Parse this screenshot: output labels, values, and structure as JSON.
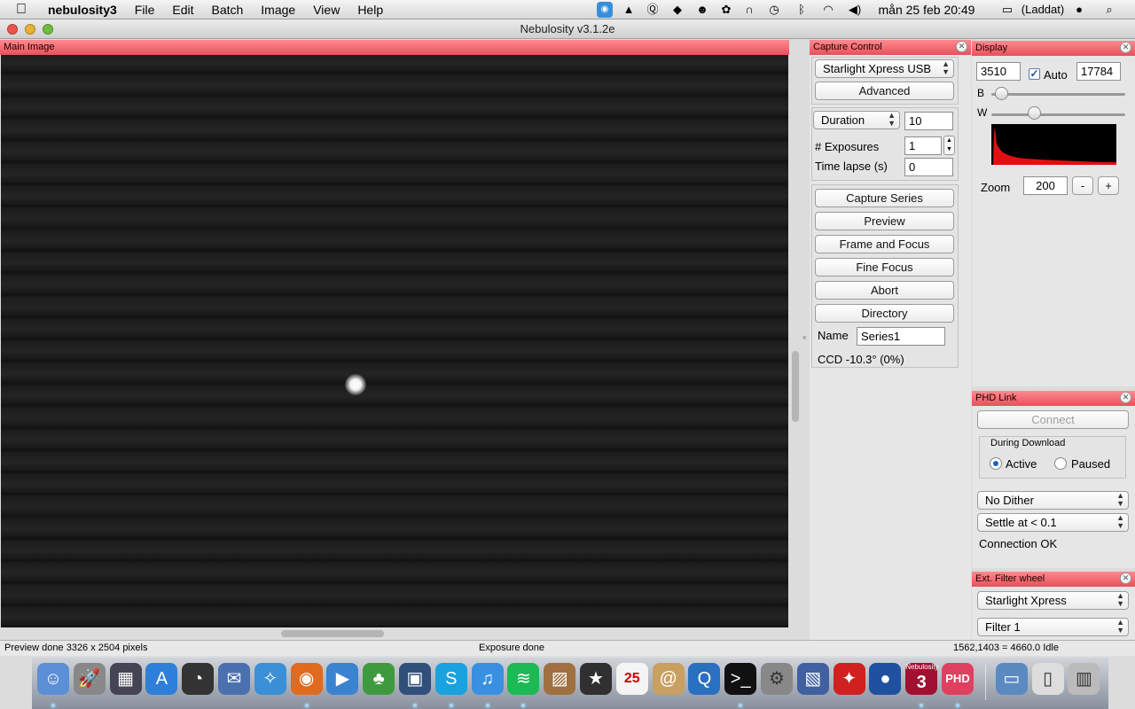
{
  "menubar": {
    "apple": "",
    "app_name": "nebulosity3",
    "items": [
      "File",
      "Edit",
      "Batch",
      "Image",
      "View",
      "Help"
    ],
    "clock": "mån 25 feb  20:49",
    "battery": "(Laddat)"
  },
  "window": {
    "title": "Nebulosity v3.1.2e"
  },
  "main_image": {
    "title": "Main Image"
  },
  "capture": {
    "title": "Capture Control",
    "camera": "Starlight Xpress USB",
    "advanced": "Advanced",
    "duration_label": "Duration",
    "duration_value": "10",
    "exposures_label": "# Exposures",
    "exposures_value": "1",
    "timelapse_label": "Time lapse (s)",
    "timelapse_value": "0",
    "buttons": {
      "capture_series": "Capture Series",
      "preview": "Preview",
      "frame_focus": "Frame and Focus",
      "fine_focus": "Fine Focus",
      "abort": "Abort",
      "directory": "Directory"
    },
    "name_label": "Name",
    "name_value": "Series1",
    "ccd_status": "CCD -10.3° (0%)"
  },
  "display": {
    "title": "Display",
    "black_value": "3510",
    "auto_label": "Auto",
    "auto_checked": true,
    "white_value": "17784",
    "b_label": "B",
    "w_label": "W",
    "b_level": 0.03,
    "w_level": 0.3,
    "zoom_label": "Zoom",
    "zoom_value": "200",
    "zoom_minus": "-",
    "zoom_plus": "+",
    "histogram_color": "#e01010"
  },
  "phd": {
    "title": "PHD Link",
    "connect": "Connect",
    "during_download": "During Download",
    "active": "Active",
    "paused": "Paused",
    "selected": "Active",
    "dither": "No Dither",
    "settle": "Settle at < 0.1",
    "status": "Connection OK"
  },
  "filter": {
    "title": "Ext. Filter wheel",
    "wheel": "Starlight Xpress",
    "filter": "Filter 1"
  },
  "status": {
    "left": "Preview done 3326 x 2504 pixels",
    "center": "Exposure done",
    "right": "1562,1403 = 4660.0  Idle"
  },
  "colors": {
    "panel_title": "#e8505a",
    "accent": "#1c5fc9"
  },
  "dock": {
    "icons": [
      "finder-icon",
      "launchpad-icon",
      "photo-booth-icon",
      "app-store-icon",
      "dashboard-icon",
      "mail-icon",
      "safari-icon",
      "firefox-icon",
      "facetime-icon",
      "evernote-icon",
      "quicktime-icon",
      "skype-icon",
      "itunes-icon",
      "spotify-icon",
      "iphoto-icon",
      "imovie-icon",
      "calendar-icon",
      "address-book-icon",
      "quicktime-x-icon",
      "terminal-icon",
      "system-preferences-icon",
      "preview-icon",
      "cardinal-icon",
      "stellarium-icon",
      "nebulosity-icon",
      "phd-icon",
      "folder-icon",
      "documents-icon",
      "trash-icon"
    ],
    "calendar_day": "25",
    "nebulosity_label": "Nebulosity",
    "nebulosity_version": "3",
    "phd_label": "PHD"
  }
}
